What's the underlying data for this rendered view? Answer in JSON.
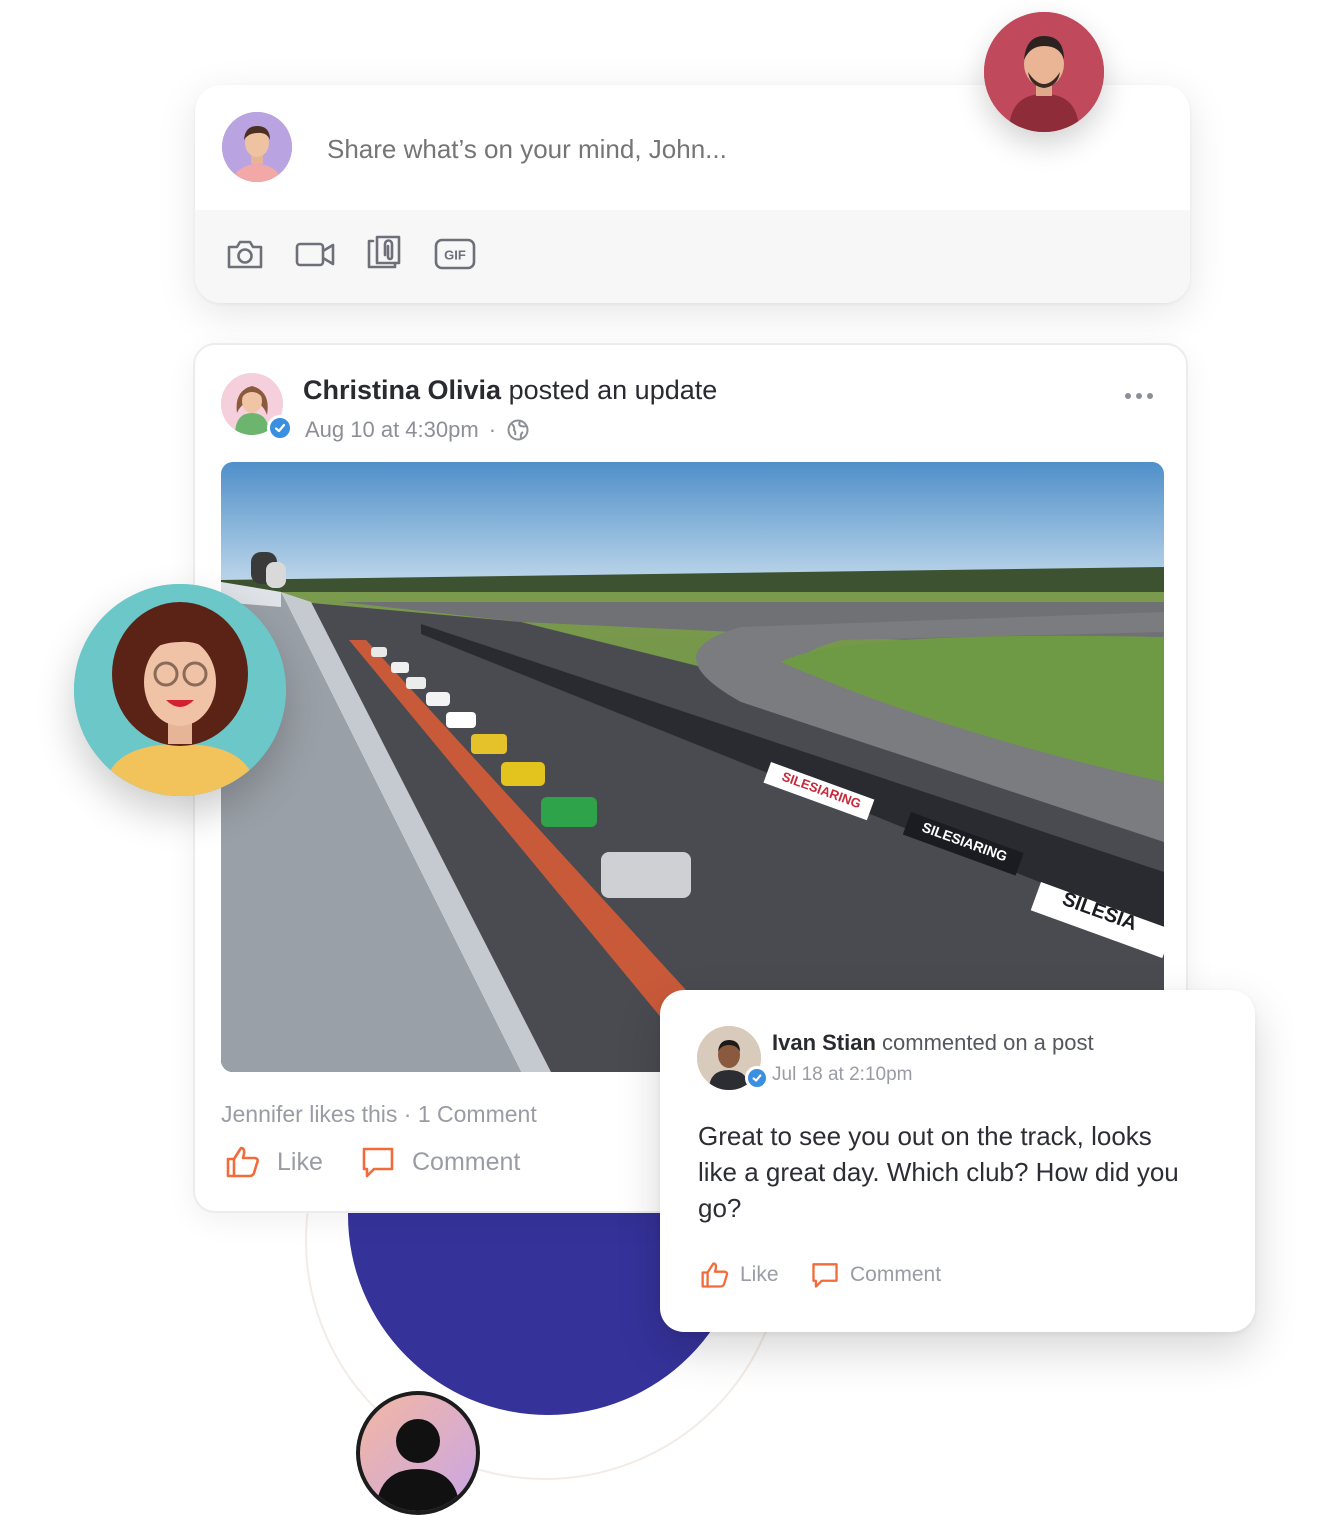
{
  "composer": {
    "placeholder": "Share what’s on your mind, John...",
    "tools": [
      {
        "icon": "camera-icon"
      },
      {
        "icon": "video-icon"
      },
      {
        "icon": "attachment-icon"
      },
      {
        "icon": "gif-icon",
        "label": "GIF"
      }
    ]
  },
  "post": {
    "author": "Christina Olivia",
    "action": "posted an update",
    "date": "Aug 10 at 4:30pm",
    "separator": "·",
    "visibility_icon": "globe-icon",
    "photo": {
      "banners": [
        "SILESIARING",
        "SILESIARING",
        "SILESIA"
      ]
    },
    "stats": "Jennifer likes this · 1 Comment",
    "like_label": "Like",
    "comment_label": "Comment"
  },
  "comment": {
    "author": "Ivan Stian",
    "action": "commented on a post",
    "date": "Jul 18 at 2:10pm",
    "text": "Great to see you out on the track, looks like a great day. Which club? How did you go?",
    "like_label": "Like",
    "comment_label": "Comment"
  },
  "colors": {
    "accent": "#f26b3a",
    "indigo": "#35329a",
    "verified": "#3b8fe0"
  }
}
